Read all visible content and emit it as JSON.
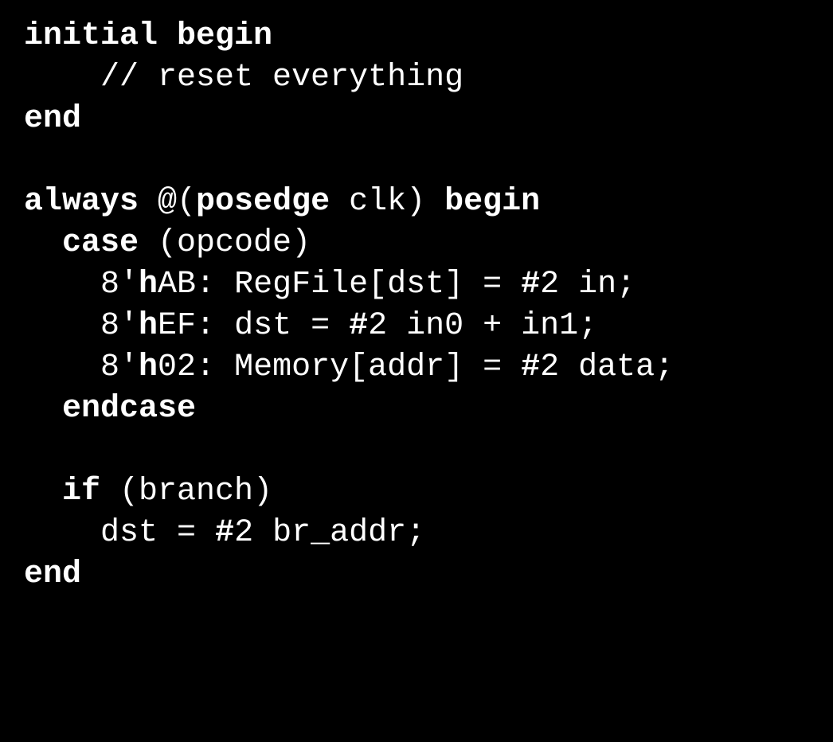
{
  "code": {
    "lines": [
      {
        "indent": 0,
        "segments": [
          {
            "t": "initial begin",
            "b": true
          }
        ]
      },
      {
        "indent": 2,
        "segments": [
          {
            "t": "// reset everything",
            "b": false
          }
        ]
      },
      {
        "indent": 0,
        "segments": [
          {
            "t": "end",
            "b": true
          }
        ]
      },
      {
        "indent": 0,
        "segments": [
          {
            "t": "",
            "b": false
          }
        ]
      },
      {
        "indent": 0,
        "segments": [
          {
            "t": "always",
            "b": true
          },
          {
            "t": " @(",
            "b": false
          },
          {
            "t": "posedge",
            "b": true
          },
          {
            "t": " clk) ",
            "b": false
          },
          {
            "t": "begin",
            "b": true
          }
        ]
      },
      {
        "indent": 1,
        "segments": [
          {
            "t": "case",
            "b": true
          },
          {
            "t": " (opcode)",
            "b": false
          }
        ]
      },
      {
        "indent": 2,
        "segments": [
          {
            "t": "8'",
            "b": false
          },
          {
            "t": "h",
            "b": true
          },
          {
            "t": "AB: RegFile[dst] = ",
            "b": false
          },
          {
            "t": "#",
            "b": true
          },
          {
            "t": "2 in;",
            "b": false
          }
        ]
      },
      {
        "indent": 2,
        "segments": [
          {
            "t": "8'",
            "b": false
          },
          {
            "t": "h",
            "b": true
          },
          {
            "t": "EF: dst = ",
            "b": false
          },
          {
            "t": "#",
            "b": true
          },
          {
            "t": "2 in0 + in1;",
            "b": false
          }
        ]
      },
      {
        "indent": 2,
        "segments": [
          {
            "t": "8'",
            "b": false
          },
          {
            "t": "h",
            "b": true
          },
          {
            "t": "02: Memory[addr] = ",
            "b": false
          },
          {
            "t": "#",
            "b": true
          },
          {
            "t": "2 data;",
            "b": false
          }
        ]
      },
      {
        "indent": 1,
        "segments": [
          {
            "t": "endcase",
            "b": true
          }
        ]
      },
      {
        "indent": 0,
        "segments": [
          {
            "t": "",
            "b": false
          }
        ]
      },
      {
        "indent": 1,
        "segments": [
          {
            "t": "if",
            "b": true
          },
          {
            "t": " (branch)",
            "b": false
          }
        ]
      },
      {
        "indent": 2,
        "segments": [
          {
            "t": "dst = ",
            "b": false
          },
          {
            "t": "#",
            "b": true
          },
          {
            "t": "2 br_addr;",
            "b": false
          }
        ]
      },
      {
        "indent": 0,
        "segments": [
          {
            "t": "end",
            "b": true
          }
        ]
      }
    ]
  }
}
